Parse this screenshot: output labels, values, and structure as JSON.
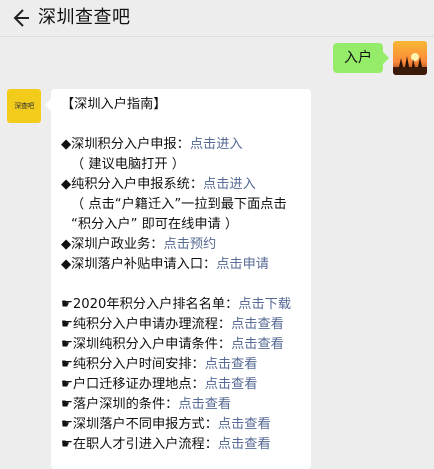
{
  "header": {
    "back_icon": "back-arrow-icon",
    "title": "深圳查查吧"
  },
  "outgoing": {
    "text": "入户",
    "bubble_color": "#95ec69"
  },
  "bot": {
    "avatar_text": "深查吧",
    "avatar_color": "#f3cc1b"
  },
  "message": {
    "heading": "【深圳入户指南】",
    "line1_prefix": "◆深圳积分入户申报：",
    "line1_link": "点击进入",
    "line2": "（ 建议电脑打开 ）",
    "line3_prefix": "◆纯积分入户申报系统：",
    "line3_link": "点击进入",
    "line4": "（ 点击“户籍迁入”一拉到最下面点击",
    "line5": "“积分入户” 即可在线申请 ）",
    "line6_prefix": "◆深圳户政业务：",
    "line6_link": "点击预约",
    "line7_prefix": "◆深圳落户补贴申请入口：",
    "line7_link": "点击申请",
    "item1_prefix": "☛2020年积分入户排名名单：",
    "item1_link": "点击下载",
    "item2_prefix": "☛纯积分入户申请办理流程：",
    "item2_link": "点击查看",
    "item3_prefix": "☛深圳纯积分入户申请条件：",
    "item3_link": "点击查看",
    "item4_prefix": "☛纯积分入户时间安排：",
    "item4_link": "点击查看",
    "item5_prefix": "☛户口迁移证办理地点：",
    "item5_link": "点击查看",
    "item6_prefix": "☛落户深圳的条件：",
    "item6_link": "点击查看",
    "item7_prefix": "☛深圳落户不同申报方式：",
    "item7_link": "点击查看",
    "item8_prefix": "☛在职人才引进入户流程：",
    "item8_link": "点击查看",
    "link_color": "#576b95"
  }
}
